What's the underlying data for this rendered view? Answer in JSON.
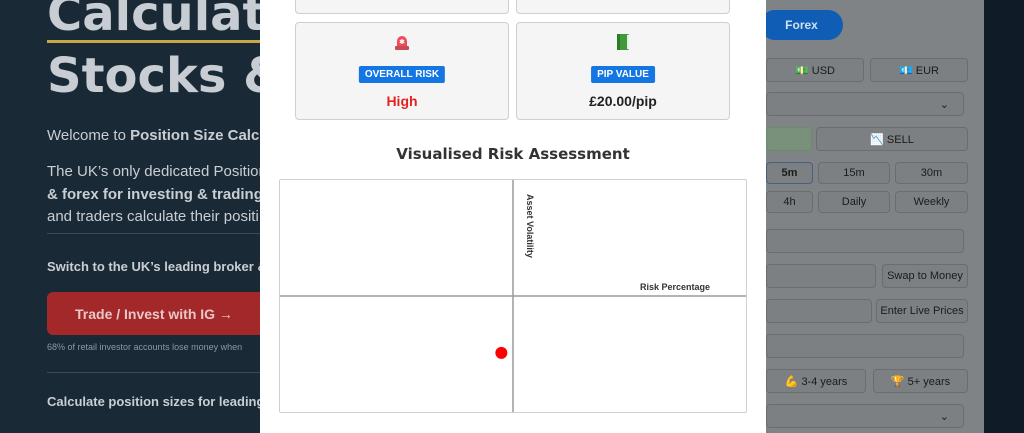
{
  "hero": {
    "heading_line1": "Calculator",
    "heading_line2": "Stocks &",
    "welcome_prefix": "Welcome to ",
    "welcome_bold": "Position Size Calcul",
    "intro_line1": "The UK’s only dedicated Position",
    "intro_line2_bold": "& forex for investing & trading.",
    "intro_line3": "and traders calculate their positi",
    "switch_text": "Switch to the UK’s leading broker &",
    "cta_label": "Trade / Invest with IG →",
    "risk_warning": "68% of retail investor accounts lose money when",
    "calc_heading": "Calculate position sizes for leading U"
  },
  "form_bg": {
    "forex_tab": "Forex",
    "currency_usd": "💵 USD",
    "currency_eur": "💶 EUR",
    "sell_label": "📉 SELL",
    "tf_5m": "5m",
    "tf_15m": "15m",
    "tf_30m": "30m",
    "tf_4h": "4h",
    "tf_daily": "Daily",
    "tf_weekly": "Weekly",
    "swap_button": "Swap to Money",
    "live_prices_button": "Enter Live Prices",
    "exp_3_4": "💪 3-4 years",
    "exp_5plus": "🏆 5+ years"
  },
  "modal": {
    "overall_risk": {
      "icon": "siren-icon",
      "label": "OVERALL RISK",
      "value": "High",
      "value_color": "#e32222"
    },
    "pip_value": {
      "icon": "green-book-icon",
      "label": "PIP VALUE",
      "value": "£20.00/pip"
    },
    "chart_title": "Visualised Risk Assessment"
  },
  "chart_data": {
    "type": "scatter",
    "title": "Visualised Risk Assessment",
    "xlabel": "Risk Percentage",
    "ylabel": "Asset Volatility",
    "grid": "quadrants",
    "points": [
      {
        "x": -0.05,
        "y": -0.49,
        "color": "#ff0000"
      }
    ],
    "xlim": [
      -1,
      1
    ],
    "ylim": [
      -1,
      1
    ]
  }
}
